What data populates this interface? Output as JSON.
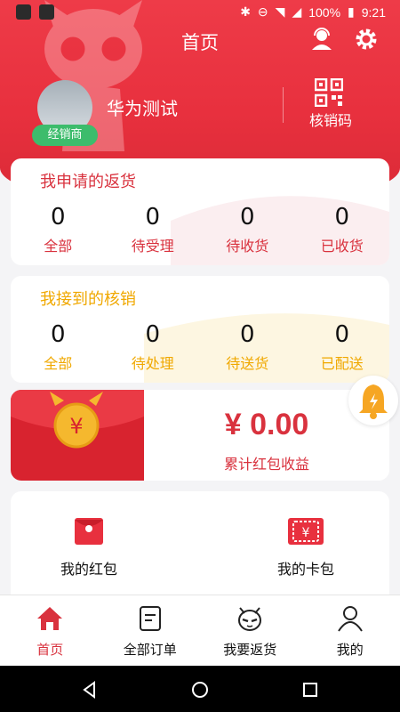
{
  "status_bar": {
    "battery": "100%",
    "time": "9:21"
  },
  "header": {
    "title": "首页"
  },
  "profile": {
    "name": "华为测试",
    "role_badge": "经销商",
    "verify_label": "核销码"
  },
  "returns_card": {
    "title": "我申请的返货",
    "title_color": "#d9323e",
    "stats": [
      {
        "count": "0",
        "label": "全部"
      },
      {
        "count": "0",
        "label": "待受理"
      },
      {
        "count": "0",
        "label": "待收货"
      },
      {
        "count": "0",
        "label": "已收货"
      }
    ]
  },
  "verify_card": {
    "title": "我接到的核销",
    "title_color": "#f0a800",
    "stats": [
      {
        "count": "0",
        "label": "全部"
      },
      {
        "count": "0",
        "label": "待处理"
      },
      {
        "count": "0",
        "label": "待送货"
      },
      {
        "count": "0",
        "label": "已配送"
      }
    ]
  },
  "red_packet": {
    "amount": "¥ 0.00",
    "label": "累计红包收益",
    "coin_symbol": "¥"
  },
  "wallet": {
    "items": [
      {
        "label": "我的红包",
        "icon": "red-envelope-icon"
      },
      {
        "label": "我的卡包",
        "icon": "card-wallet-icon"
      }
    ]
  },
  "tabs": [
    {
      "label": "首页",
      "icon": "home-icon",
      "active": true
    },
    {
      "label": "全部订单",
      "icon": "orders-icon",
      "active": false
    },
    {
      "label": "我要返货",
      "icon": "mascot-face-icon",
      "active": false
    },
    {
      "label": "我的",
      "icon": "user-icon",
      "active": false
    }
  ],
  "colors": {
    "brand_red": "#e8303e",
    "accent_text_red": "#d9323e",
    "accent_yellow": "#f0a800",
    "badge_green": "#3dbc6c"
  }
}
